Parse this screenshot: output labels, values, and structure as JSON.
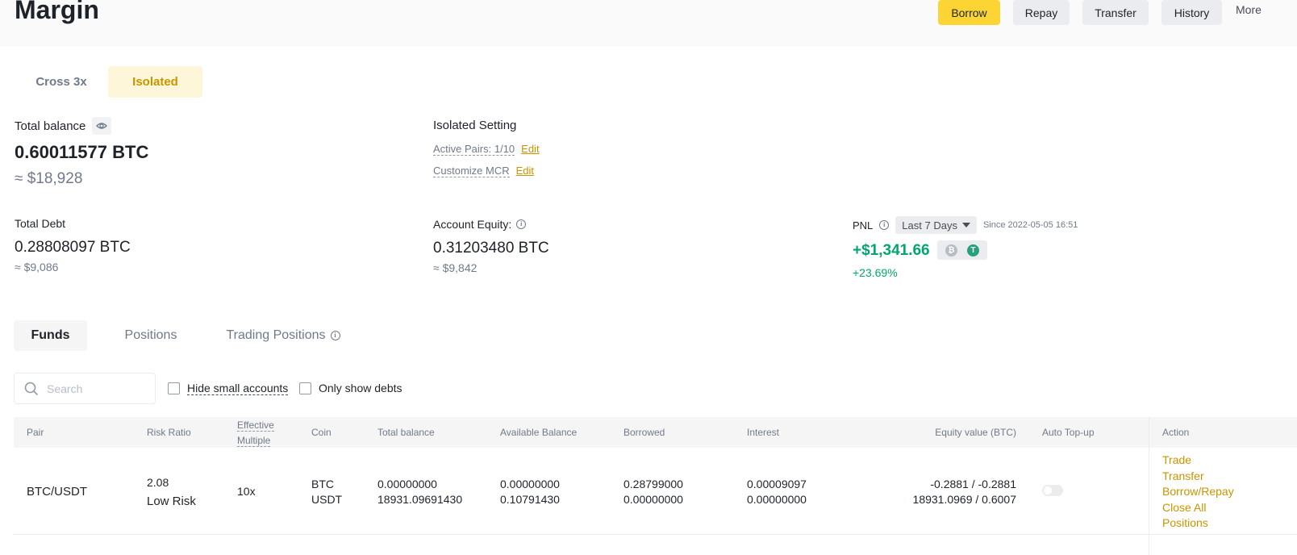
{
  "header": {
    "title": "Margin",
    "buttons": {
      "borrow": "Borrow",
      "repay": "Repay",
      "transfer": "Transfer",
      "history": "History"
    },
    "more": "More"
  },
  "mode_tabs": {
    "cross": "Cross 3x",
    "isolated": "Isolated",
    "active": "isolated"
  },
  "total_balance": {
    "label": "Total balance",
    "btc": "0.60011577 BTC",
    "usd": "≈ $18,928"
  },
  "isolated_setting": {
    "title": "Isolated Setting",
    "active_pairs": "Active Pairs: 1/10",
    "customize_mcr": "Customize MCR",
    "edit": "Edit"
  },
  "total_debt": {
    "label": "Total Debt",
    "btc": "0.28808097 BTC",
    "usd": "≈ $9,086"
  },
  "account_equity": {
    "label": "Account Equity:",
    "btc": "0.31203480 BTC",
    "usd": "≈ $9,842"
  },
  "pnl": {
    "label": "PNL",
    "period": "Last 7 Days",
    "since": "Since 2022-05-05 16:51",
    "value": "+$1,341.66",
    "percent": "+23.69%",
    "coin_btc": "₿",
    "coin_usdt": "T"
  },
  "sub_tabs": {
    "funds": "Funds",
    "positions": "Positions",
    "trading_positions": "Trading Positions",
    "active": "funds"
  },
  "filters": {
    "search_placeholder": "Search",
    "hide_small": "Hide small accounts",
    "only_debts": "Only show debts"
  },
  "table": {
    "headers": {
      "pair": "Pair",
      "risk_ratio": "Risk Ratio",
      "effective_1": "Effective",
      "effective_2": "Multiple",
      "coin": "Coin",
      "total_balance": "Total balance",
      "available_balance": "Available Balance",
      "borrowed": "Borrowed",
      "interest": "Interest",
      "equity_value": "Equity value (BTC)",
      "auto_topup": "Auto Top-up",
      "action": "Action"
    },
    "rows": [
      {
        "pair": "BTC/USDT",
        "risk_ratio": "2.08",
        "risk_level": "Low Risk",
        "multiple": "10x",
        "coin_1": "BTC",
        "coin_2": "USDT",
        "total_1": "0.00000000",
        "total_2": "18931.09691430",
        "avail_1": "0.00000000",
        "avail_2": "0.10791430",
        "borrowed_1": "0.28799000",
        "borrowed_2": "0.00000000",
        "interest_1": "0.00009097",
        "interest_2": "0.00000000",
        "equity_1": "-0.2881 / -0.2881",
        "equity_2": "18931.0969 / 0.6007",
        "auto_topup": false,
        "actions": [
          "Trade",
          "Transfer",
          "Borrow/Repay",
          "Close All",
          "Positions"
        ]
      }
    ]
  },
  "colors": {
    "accent": "#fcd535",
    "gold": "#c99400",
    "green": "#03a66d",
    "red": "#cf304a"
  }
}
